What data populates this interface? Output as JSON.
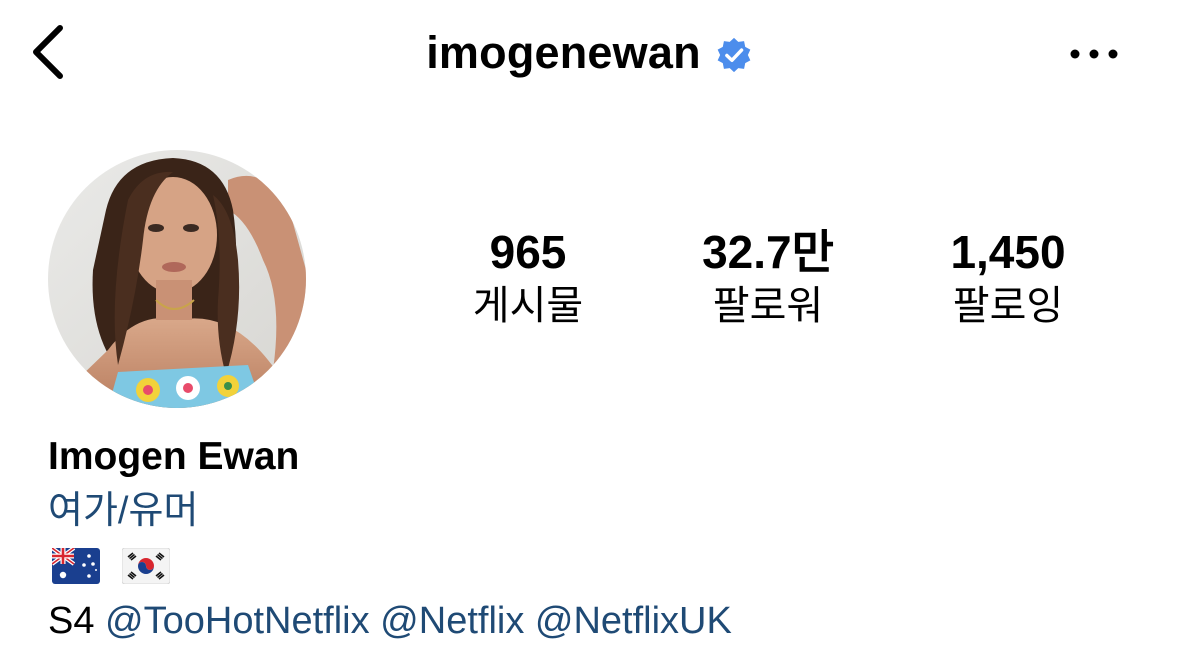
{
  "header": {
    "username": "imogenewan",
    "back_icon": "chevron-left-icon",
    "verified_icon": "verified-badge-icon",
    "more_icon": "more-horizontal-icon",
    "verified_color": "#4c8dec"
  },
  "stats": {
    "posts": {
      "value": "965",
      "label": "게시물"
    },
    "followers": {
      "value": "32.7만",
      "label": "팔로워"
    },
    "following": {
      "value": "1,450",
      "label": "팔로잉"
    }
  },
  "bio": {
    "full_name": "Imogen Ewan",
    "category": "여가/유머",
    "flags": [
      "australia-flag-icon",
      "south-korea-flag-icon"
    ],
    "prefix": "S4",
    "mentions": [
      "@TooHotNetflix",
      "@Netflix",
      "@NetflixUK"
    ]
  },
  "colors": {
    "link": "#1f4a75",
    "text": "#000000"
  }
}
